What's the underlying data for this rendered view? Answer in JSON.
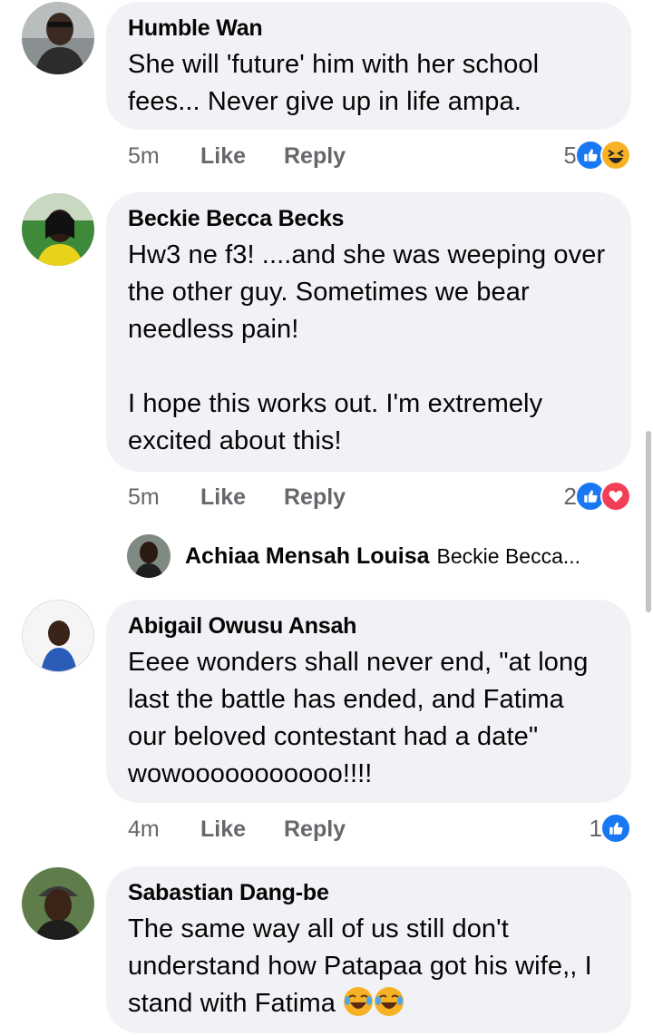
{
  "comments": [
    {
      "author": "Humble Wan",
      "text": "She will 'future' him with her school fees... Never give up in life ampa.",
      "time": "5m",
      "like_label": "Like",
      "reply_label": "Reply",
      "reaction_count": "5",
      "reactions": [
        "like-icon",
        "haha-icon"
      ]
    },
    {
      "author": "Beckie Becca Becks",
      "text": "Hw3 ne f3! ....and she was weeping over the other guy. Sometimes we bear needless pain!\n\nI hope this works out. I'm extremely excited about this!",
      "time": "5m",
      "like_label": "Like",
      "reply_label": "Reply",
      "reaction_count": "2",
      "reactions": [
        "like-icon",
        "love-icon"
      ],
      "reply": {
        "author": "Achiaa Mensah Louisa",
        "preview": "Beckie Becca..."
      }
    },
    {
      "author": "Abigail Owusu Ansah",
      "text": "Eeee wonders shall never end, \"at long last the battle has ended, and Fatima our beloved contestant had a date\" wowooooooooooo!!!!",
      "time": "4m",
      "like_label": "Like",
      "reply_label": "Reply",
      "reaction_count": "1",
      "reactions": [
        "like-icon"
      ]
    },
    {
      "author": "Sabastian Dang-be",
      "text": "The same way all of us still don't understand how Patapaa got his wife,, I stand with Fatima",
      "emoji": [
        "laughing-tears-emoji",
        "laughing-tears-emoji"
      ]
    }
  ],
  "colors": {
    "bubble": "#f0f2f5",
    "meta_text": "#65676b",
    "like_blue": "#1877f2",
    "love_red": "#f33e58",
    "haha_yellow": "#f7b125"
  }
}
